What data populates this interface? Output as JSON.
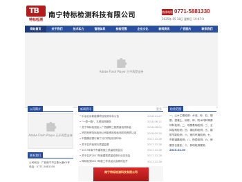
{
  "header": {
    "logo_mark": "TB",
    "logo_text": "特标检测",
    "company": "南宁特标检测科技有限公司",
    "phone_label": "热线电话",
    "phone": "0771-5881330",
    "datetime": "2025年 05 18日 星期日 19:47:0"
  },
  "nav": [
    "网站首页",
    "关于我们",
    "技术实力",
    "管理体系",
    "检验范围",
    "企业文化",
    "新闻资讯",
    "广西图片",
    "联系我们"
  ],
  "banner": {
    "plugin_text": "Adobe Flash Player 已不再受支持"
  },
  "profile": {
    "title": "公司简介",
    "plugin_text": "Adobe Flash Player 已不再受支持"
  },
  "news": {
    "title": "新闻资讯",
    "more": "更多",
    "items": [
      {
        "t": "中冶北京新能源项目检测中标公告",
        "d": "2018-11-27"
      },
      {
        "t": "\"一带一路\"，扎根检测服务",
        "d": "2018-06-11"
      },
      {
        "t": "关于特标检测加入广西建筑工程质量检测协会",
        "d": "2018-06-01"
      },
      {
        "t": "热烈祝贺特标检测公司取得检验检测机构资质认定",
        "d": "2018-05-20"
      },
      {
        "t": "中国建设银行南宁分行项目检测中标",
        "d": "2017-12-28"
      },
      {
        "t": "关于召开检测与质量监督",
        "d": "2017-12-28"
      },
      {
        "t": "2017年南宁市建筑施工质量检测会议",
        "d": "2017-12-28"
      },
      {
        "t": "关于召开2017年度建筑质量检测行业交流会",
        "d": "2017-12-28"
      },
      {
        "t": "特标检测2017年度工作总结大会顺利召开",
        "d": "2017-12-28"
      }
    ]
  },
  "scope": {
    "title": "检验范围",
    "text": "一、土木工程检测：水泥、砂、石、钢筋、混凝土、砂浆、砖、防水材料等原材料检测；二、地基基础检测；三、主体结构检测；四、钢结构检测；五、建筑节能检测；六、室内环境检测；七、市政道路检测；八、桥梁检测；九、房屋安全鉴定；十、其他检测服务。",
    "date": "2025.04.03"
  },
  "contact": {
    "title": "联系我们",
    "text": "公司地址：广西南宁市五象大道XX号 电话：0771-5881330"
  },
  "bottom": {
    "strip_text": "南宁特标检测科技有限公司"
  }
}
